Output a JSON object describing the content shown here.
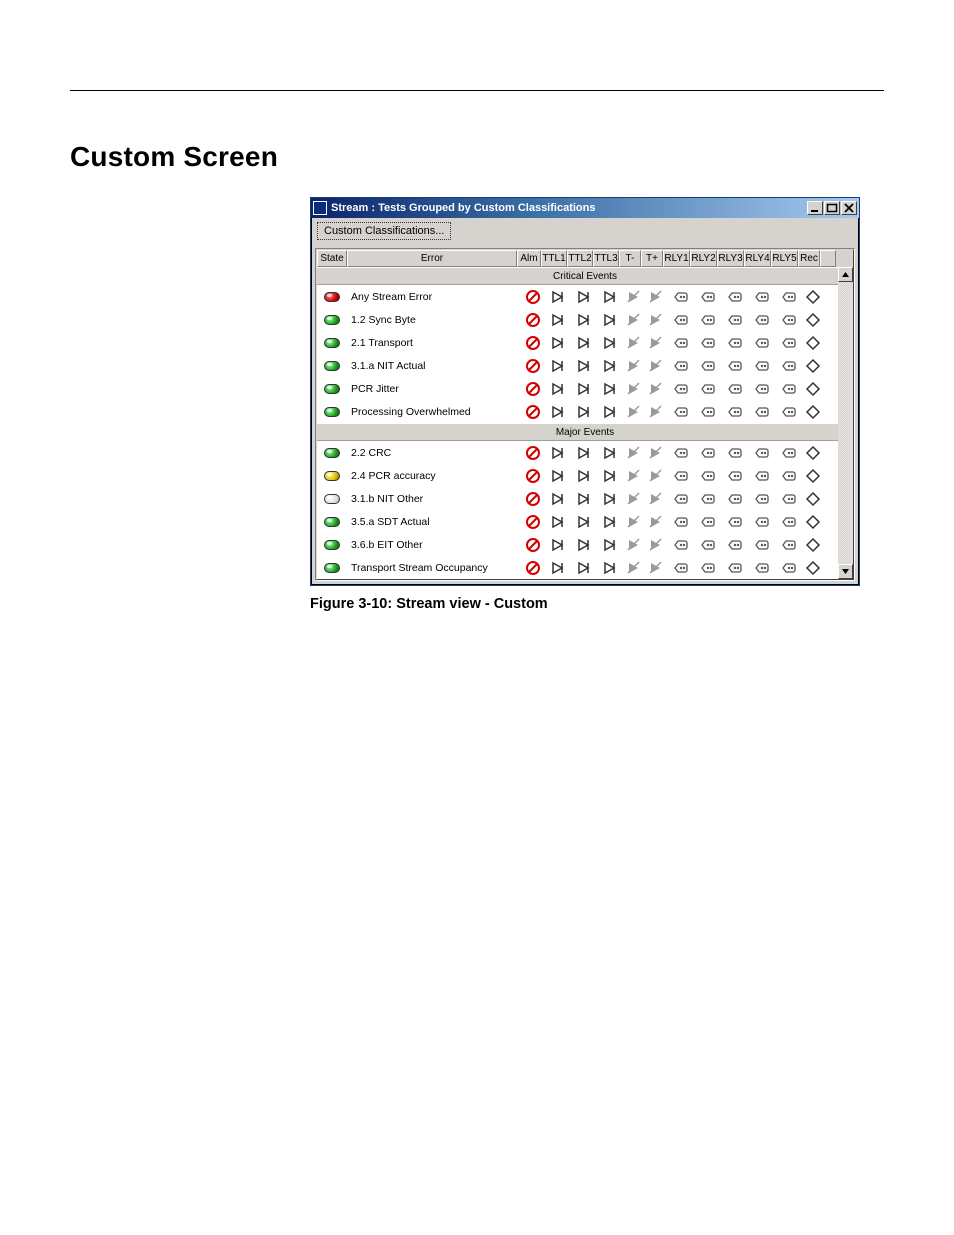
{
  "page": {
    "heading": "Custom Screen",
    "caption": "Figure 3-10: Stream view - Custom"
  },
  "window": {
    "title": "Stream : Tests Grouped by Custom Classifications",
    "toolbar": {
      "custom_btn": "Custom Classifications..."
    },
    "columns": {
      "state": "State",
      "error": "Error",
      "alm": "Alm",
      "ttl1": "TTL1",
      "ttl2": "TTL2",
      "ttl3": "TTL3",
      "tminus": "T-",
      "tplus": "T+",
      "rly1": "RLY1",
      "rly2": "RLY2",
      "rly3": "RLY3",
      "rly4": "RLY4",
      "rly5": "RLY5",
      "rec": "Rec"
    },
    "groups": [
      {
        "title": "Critical Events",
        "rows": [
          {
            "state": "red",
            "label": "Any Stream Error"
          },
          {
            "state": "green",
            "label": "1.2 Sync Byte"
          },
          {
            "state": "green",
            "label": "2.1 Transport"
          },
          {
            "state": "green",
            "label": "3.1.a NIT Actual"
          },
          {
            "state": "green",
            "label": "PCR Jitter"
          },
          {
            "state": "green",
            "label": "Processing Overwhelmed"
          }
        ]
      },
      {
        "title": "Major Events",
        "rows": [
          {
            "state": "green",
            "label": "2.2 CRC"
          },
          {
            "state": "yellow",
            "label": "2.4 PCR accuracy"
          },
          {
            "state": "off",
            "label": "3.1.b NIT Other"
          },
          {
            "state": "green",
            "label": "3.5.a SDT Actual"
          },
          {
            "state": "green",
            "label": "3.6.b EIT Other"
          },
          {
            "state": "green",
            "label": "Transport Stream Occupancy"
          }
        ]
      }
    ]
  }
}
